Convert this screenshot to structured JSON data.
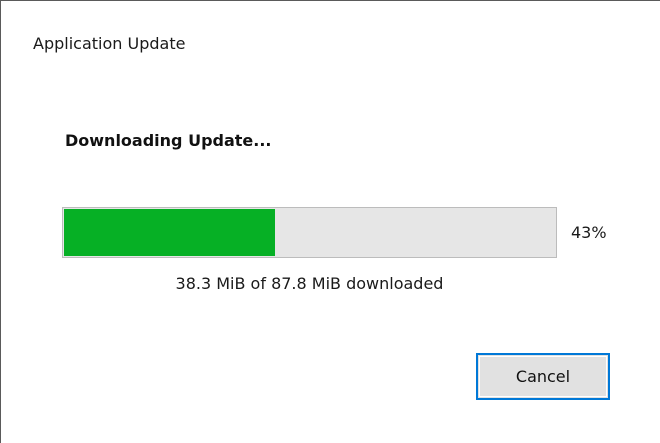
{
  "window": {
    "title": "Application Update"
  },
  "content": {
    "heading": "Downloading Update...",
    "progress": {
      "percent": 43,
      "percent_label": "43%",
      "fill_color": "#06b025",
      "track_color": "#e6e6e6"
    },
    "status": "38.3 MiB of 87.8 MiB downloaded"
  },
  "buttons": {
    "cancel_label": "Cancel",
    "focus_color": "#0078d7"
  }
}
